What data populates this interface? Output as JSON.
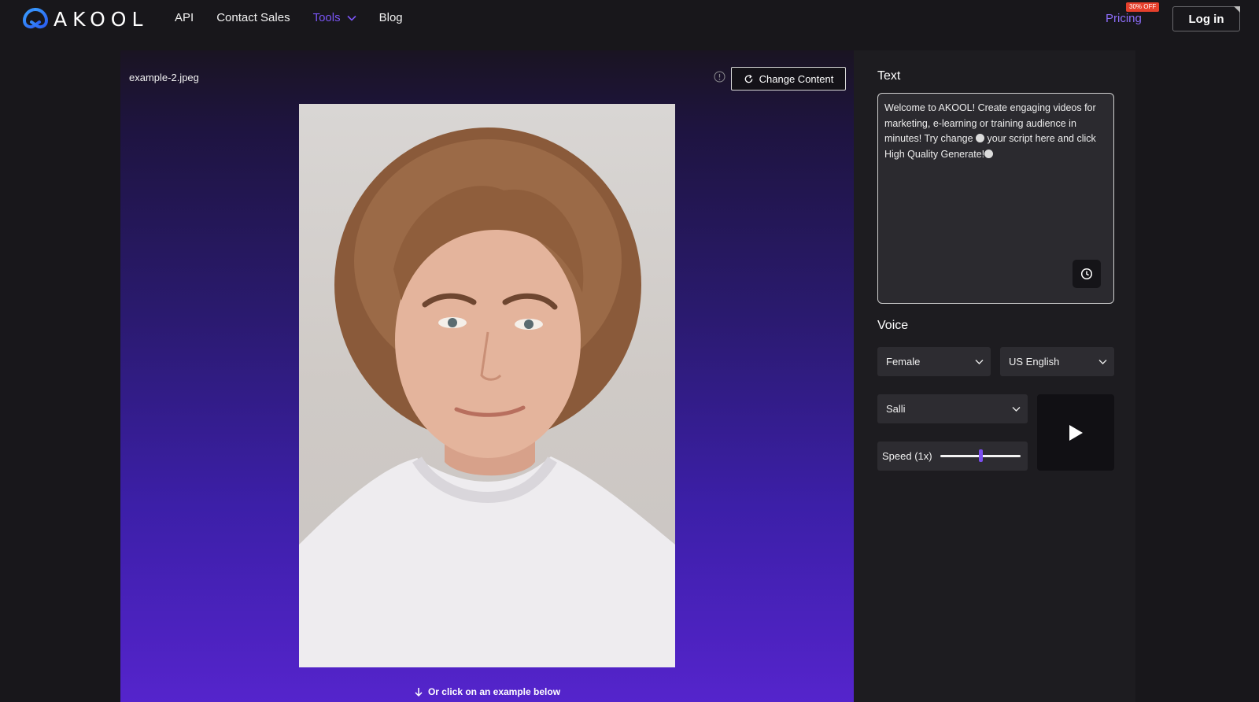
{
  "header": {
    "logo_text": "AKOOL",
    "nav": [
      {
        "label": "API",
        "active": false
      },
      {
        "label": "Contact Sales",
        "active": false
      },
      {
        "label": "Tools",
        "active": true,
        "has_dropdown": true
      },
      {
        "label": "Blog",
        "active": false
      }
    ],
    "pricing_label": "Pricing",
    "pricing_badge": "30% OFF",
    "login_label": "Log in"
  },
  "preview": {
    "filename": "example-2.jpeg",
    "change_button_label": "Change Content",
    "example_hint": "Or click on an example below"
  },
  "text_section": {
    "label": "Text",
    "script_parts": [
      "Welcome to AKOOL! Create engaging videos for marketing, e-learning or training audience in minutes! Try change ",
      " your script here and click High Quality Generate!"
    ]
  },
  "voice_section": {
    "label": "Voice",
    "gender_value": "Female",
    "language_value": "US English",
    "voice_value": "Salli",
    "speed_label": "Speed (1x)",
    "speed_level": 0.5
  },
  "colors": {
    "accent": "#7a55f5",
    "badge": "#e5402c",
    "gradient_bottom": "#5524cc"
  },
  "icons": [
    "logo-mark-icon",
    "chevron-down-icon",
    "info-icon",
    "refresh-icon",
    "arrow-down-icon",
    "history-icon",
    "play-icon"
  ]
}
